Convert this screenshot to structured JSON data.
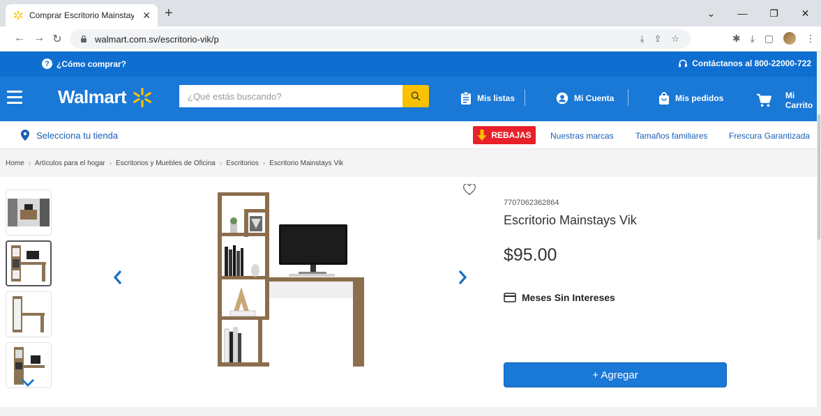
{
  "browser": {
    "tab_title": "Comprar Escritorio Mainstays Vik",
    "url": "walmart.com.sv/escritorio-vik/p"
  },
  "topbar": {
    "how_to_buy": "¿Cómo comprar?",
    "contact": "Contáctanos al 800-22000-722"
  },
  "header": {
    "logo": "Walmart",
    "search_placeholder": "¿Qué estás buscando?",
    "my_lists": "Mis listas",
    "my_account": "Mi Cuenta",
    "my_orders": "Mis pedidos",
    "my_cart": "Mi Carrito"
  },
  "subnav": {
    "select_store": "Selecciona tu tienda",
    "sale": "REBAJAS",
    "our_brands": "Nuestras marcas",
    "family_sizes": "Tamaños familiares",
    "freshness": "Frescura Garantizada"
  },
  "breadcrumb": [
    "Home",
    "Artículos para el hogar",
    "Escritorios y Muebles de Oficina",
    "Escritorios",
    "Escritorio Mainstays Vik"
  ],
  "product": {
    "sku": "7707062362864",
    "name": "Escritorio Mainstays Vik",
    "price": "$95.00",
    "installments": "Meses Sin Intereses",
    "add_button": "+ Agregar"
  },
  "colors": {
    "walmart_blue": "#1a78d6",
    "topstrip_blue": "#0f6fd0",
    "spark_yellow": "#f9c100",
    "sale_red": "#e8202a"
  }
}
